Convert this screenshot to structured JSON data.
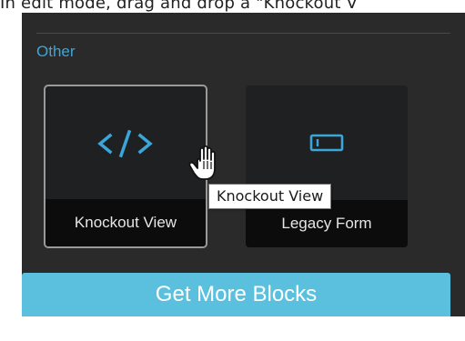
{
  "caption": {
    "text": "In edit mode, drag and drop a \"Knockout V"
  },
  "panel": {
    "section_title": "Other",
    "blocks": [
      {
        "label": "Knockout View",
        "icon": "code-icon",
        "selected": true
      },
      {
        "label": "Legacy Form",
        "icon": "form-field-icon",
        "selected": false
      }
    ],
    "tooltip": "Knockout View",
    "get_more_label": "Get More Blocks"
  },
  "colors": {
    "panel_bg": "#2a2a2a",
    "tile_bg": "#1f2022",
    "tile_footer_bg": "#0c0c0d",
    "accent": "#3aa6d9",
    "button_bg": "#5bc0de"
  }
}
